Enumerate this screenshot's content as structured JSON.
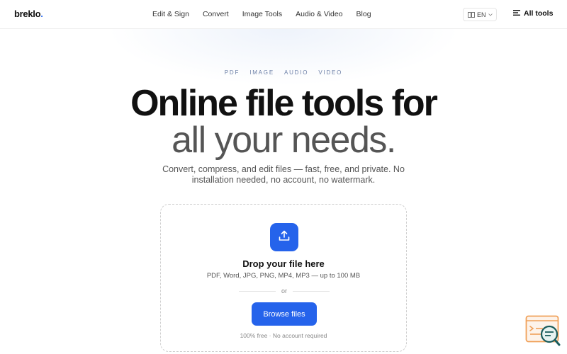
{
  "nav": {
    "logo_text": "breklo",
    "logo_dot": ".",
    "links": [
      "Edit & Sign",
      "Convert",
      "Image Tools",
      "Audio & Video",
      "Blog"
    ],
    "language": "EN",
    "all_tools_label": "All tools"
  },
  "hero": {
    "categories": [
      "PDF",
      "IMAGE",
      "AUDIO",
      "VIDEO"
    ],
    "title_line1": "Online file tools for",
    "title_line2": "all your needs.",
    "subtitle": "Convert, compress, and edit files — fast, free, and private. No installation needed, no account, no watermark."
  },
  "dropzone": {
    "title": "Drop your file here",
    "formats": "PDF, Word, JPG, PNG, MP4, MP3 — up to 100 MB",
    "or_text": "or",
    "browse_label": "Browse files",
    "note": "100% free · No account required"
  },
  "icons": {
    "upload": "upload-icon",
    "language": "translate-icon",
    "menu": "menu-icon",
    "help": "chat-search-icon"
  },
  "colors": {
    "accent": "#2563eb",
    "category_text": "#6b7fa6",
    "widget_orange": "#f0a15a",
    "widget_teal": "#1a5c5c"
  }
}
